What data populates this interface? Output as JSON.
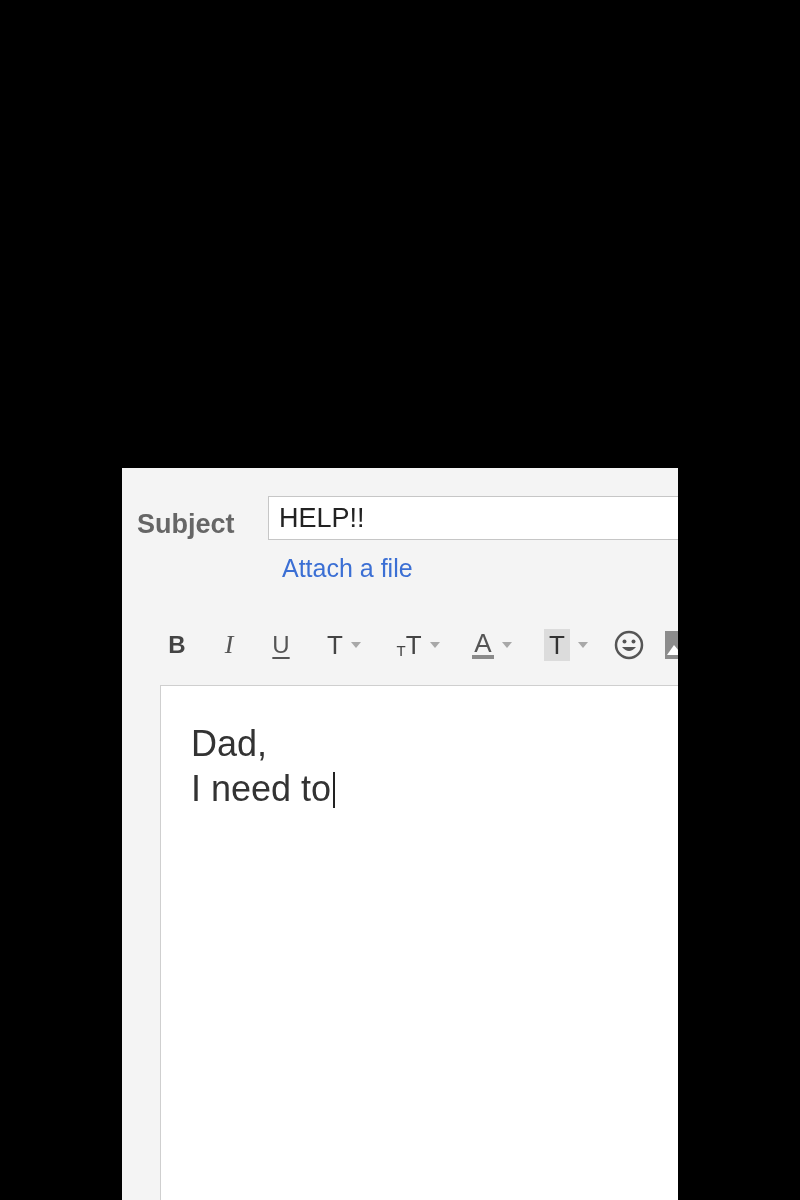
{
  "subject": {
    "label": "Subject",
    "value": "HELP!!"
  },
  "attach_link": "Attach a file",
  "toolbar": [
    {
      "kind": "bold",
      "glyph": "B",
      "menu": false
    },
    {
      "kind": "italic",
      "glyph": "I",
      "menu": false
    },
    {
      "kind": "underline",
      "glyph": "U",
      "menu": false
    },
    {
      "kind": "font",
      "glyph": "T",
      "menu": true
    },
    {
      "kind": "size",
      "glyph": "TT",
      "menu": true
    },
    {
      "kind": "text_color",
      "glyph": "A",
      "menu": true
    },
    {
      "kind": "highlight",
      "glyph": "T",
      "menu": true
    },
    {
      "kind": "emoji",
      "menu": false
    },
    {
      "kind": "image",
      "menu": false
    }
  ],
  "body": {
    "lines": [
      "Dad,",
      "I need to"
    ],
    "cursor": true
  }
}
